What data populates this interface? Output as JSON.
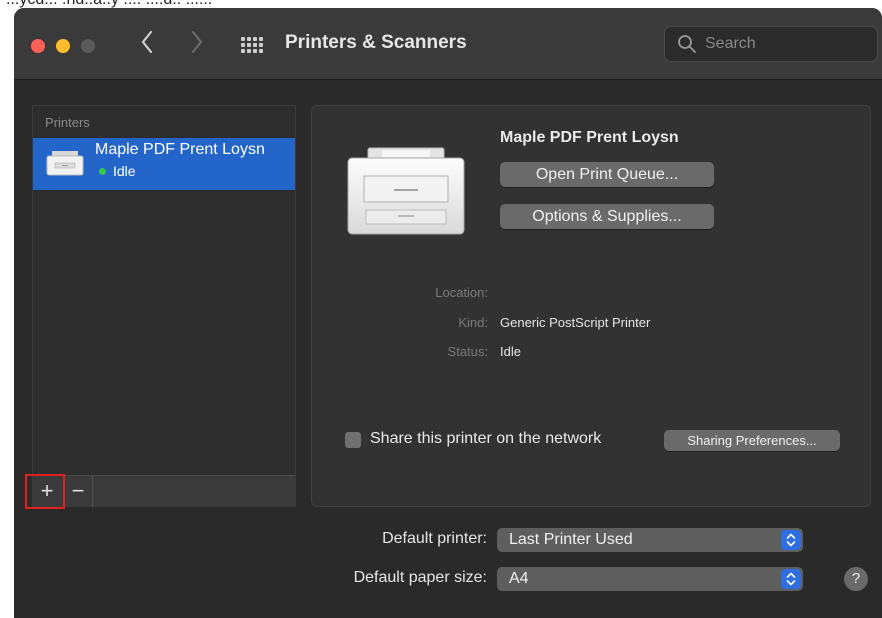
{
  "caption": "...ycd... .nd..a..y .... ....d.. ......",
  "window": {
    "title": "Printers & Scanners",
    "search_placeholder": "Search"
  },
  "printers_list": {
    "header": "Printers",
    "items": [
      {
        "name": "Maple PDF Prent Loysn",
        "status": "Idle"
      }
    ],
    "add_label": "+",
    "remove_label": "−"
  },
  "detail": {
    "printer_name": "Maple PDF Prent Loysn",
    "open_queue_label": "Open Print Queue...",
    "options_label": "Options & Supplies...",
    "location_label": "Location:",
    "location_value": "",
    "kind_label": "Kind:",
    "kind_value": "Generic PostScript Printer",
    "status_label": "Status:",
    "status_value": "Idle",
    "share_label": "Share this printer on the network",
    "share_checked": false,
    "sharing_prefs_label": "Sharing Preferences..."
  },
  "settings": {
    "default_printer_label": "Default printer:",
    "default_printer_value": "Last Printer Used",
    "default_paper_label": "Default paper size:",
    "default_paper_value": "A4",
    "help_label": "?"
  },
  "colors": {
    "selection": "#2465c9",
    "idle_dot": "#3ac64a",
    "popup_arrow": "#2f6ee0",
    "highlight": "#e02020"
  }
}
